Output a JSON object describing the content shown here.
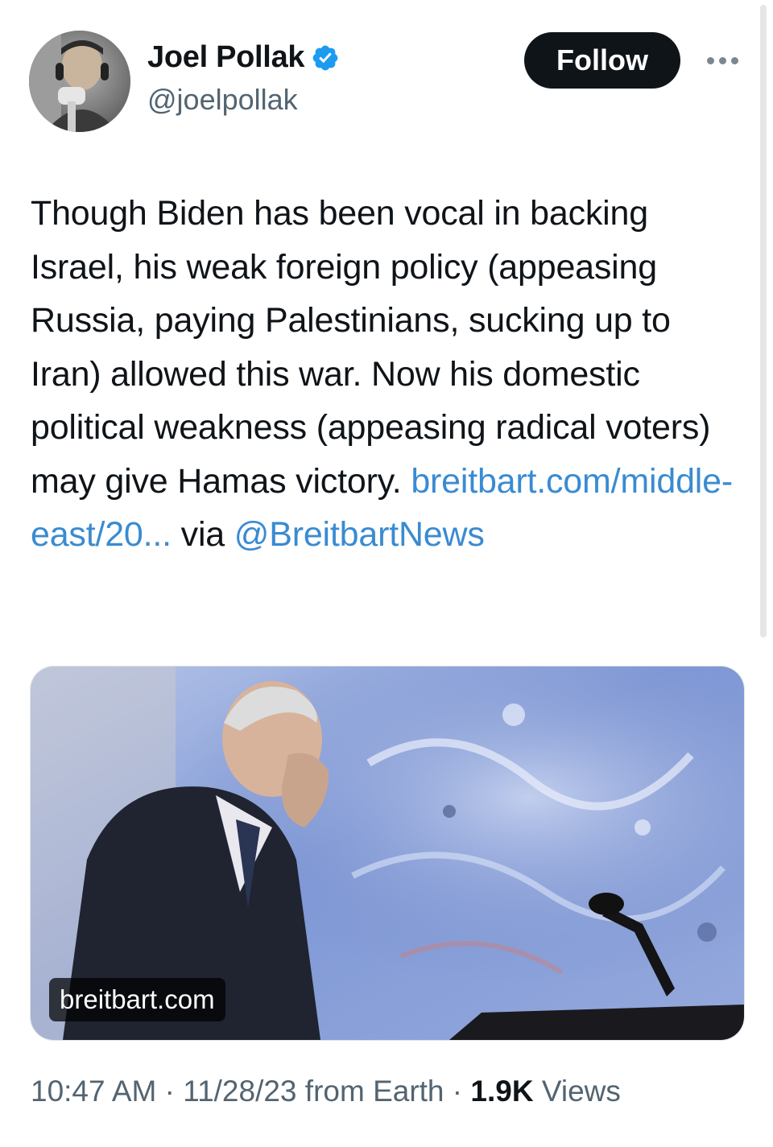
{
  "tweet": {
    "author": {
      "display_name": "Joel Pollak",
      "handle": "@joelpollak",
      "verified_icon": "verified-badge-icon",
      "verified_color": "#1d9bf0"
    },
    "follow_label": "Follow",
    "more_icon": "more-horizontal-icon",
    "text": "Though Biden has been vocal in backing Israel, his weak foreign policy (appeasing Russia, paying Palestinians, sucking up to Iran) allowed this war. Now his domestic political weakness (appeasing radical voters) may give Hamas victory.",
    "link_text": "breitbart.com/middle-east/20...",
    "via_text": "via",
    "mention": "@BreitbartNews",
    "link_color": "#3a8bd1",
    "media": {
      "domain_label": "breitbart.com"
    },
    "meta": {
      "time": "10:47 AM",
      "separator": "·",
      "date": "11/28/23",
      "source": "from Earth",
      "views_count": "1.9K",
      "views_label": "Views"
    }
  }
}
